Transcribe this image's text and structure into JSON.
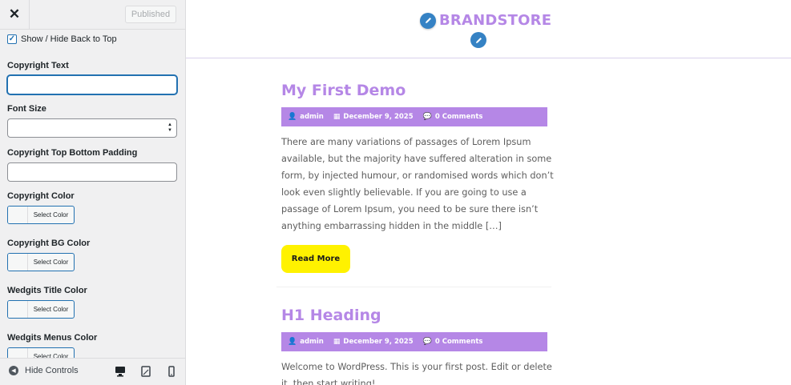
{
  "sidebar": {
    "close_glyph": "✕",
    "publish_label": "Published",
    "show_hide_back_to_top": {
      "label": "Show / Hide Back to Top",
      "checked": true
    },
    "fields": {
      "copyright_text": {
        "label": "Copyright Text",
        "value": ""
      },
      "font_size": {
        "label": "Font Size",
        "value": ""
      },
      "copyright_padding": {
        "label": "Copyright Top Bottom Padding",
        "value": ""
      },
      "copyright_color": {
        "label": "Copyright Color",
        "button": "Select Color"
      },
      "copyright_bg_color": {
        "label": "Copyright BG Color",
        "button": "Select Color"
      },
      "widgets_title_color": {
        "label": "Wedgits Title Color",
        "button": "Select Color"
      },
      "widgets_menus_color": {
        "label": "Wedgits Menus Color",
        "button": "Select Color"
      }
    },
    "footer": {
      "hide_controls_label": "Hide Controls",
      "devices": [
        "desktop",
        "tablet",
        "mobile"
      ],
      "active_device": "desktop"
    }
  },
  "preview": {
    "brand": "BRANDSTORE",
    "posts": [
      {
        "title": "My First Demo",
        "author": "admin",
        "date": "December 9, 2025",
        "comments": "0 Comments",
        "excerpt": "There are many variations of passages of Lorem Ipsum available, but the majority have suffered alteration in some form, by injected humour, or randomised words which don’t look even slightly believable. If you are going to use a passage of Lorem Ipsum, you need to be sure there isn’t anything embarrassing hidden in the middle […]",
        "read_more": "Read More"
      },
      {
        "title": "H1 Heading",
        "author": "admin",
        "date": "December 9, 2025",
        "comments": "0 Comments",
        "excerpt": "Welcome to WordPress. This is your first post. Edit or delete it, then start writing!"
      }
    ]
  },
  "colors": {
    "accent_purple": "#b587e6",
    "read_more_yellow": "#fff200",
    "wp_blue": "#2271b1"
  }
}
